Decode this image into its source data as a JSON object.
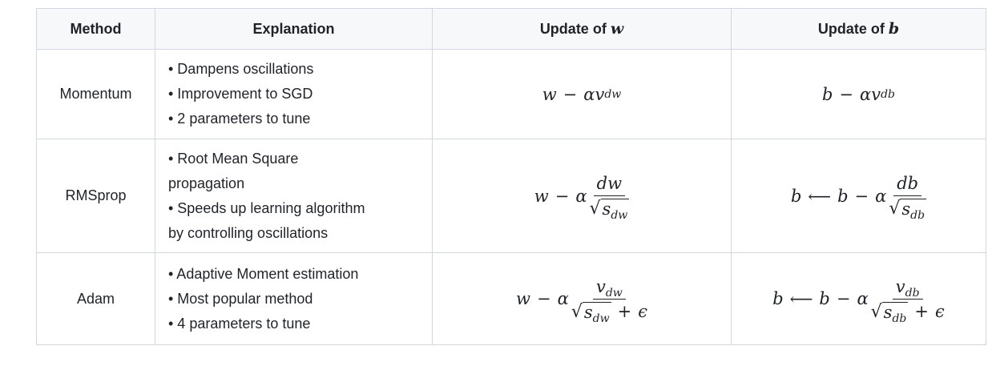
{
  "headers": {
    "method": "Method",
    "explanation": "Explanation",
    "update_w": "Update of",
    "update_w_var": "w",
    "update_b": "Update of",
    "update_b_var": "b"
  },
  "rows": [
    {
      "method": "Momentum",
      "explanation": [
        "• Dampens oscillations",
        "• Improvement to SGD",
        "• 2 parameters to tune"
      ],
      "update_w": "w − αv_dw",
      "update_b": "b − αv_db"
    },
    {
      "method": "RMSprop",
      "explanation": [
        "• Root Mean Square",
        "propagation",
        "• Speeds up learning algorithm",
        "by controlling oscillations"
      ],
      "update_w": "w − α dw/√s_dw",
      "update_b": "b ⟵ b − α db/√s_db"
    },
    {
      "method": "Adam",
      "explanation": [
        "• Adaptive Moment estimation",
        "• Most popular method",
        "• 4 parameters to tune"
      ],
      "update_w": "w − α v_dw/(√s_dw + ϵ)",
      "update_b": "b ⟵ b − α v_db/(√s_db + ϵ)"
    }
  ],
  "symbols": {
    "w": "w",
    "b": "b",
    "alpha": "α",
    "minus": "−",
    "plus": "+",
    "epsilon": "ϵ",
    "arrow": "⟵",
    "radical": "√",
    "v": "v",
    "s": "s",
    "dw": "dw",
    "db": "db"
  }
}
